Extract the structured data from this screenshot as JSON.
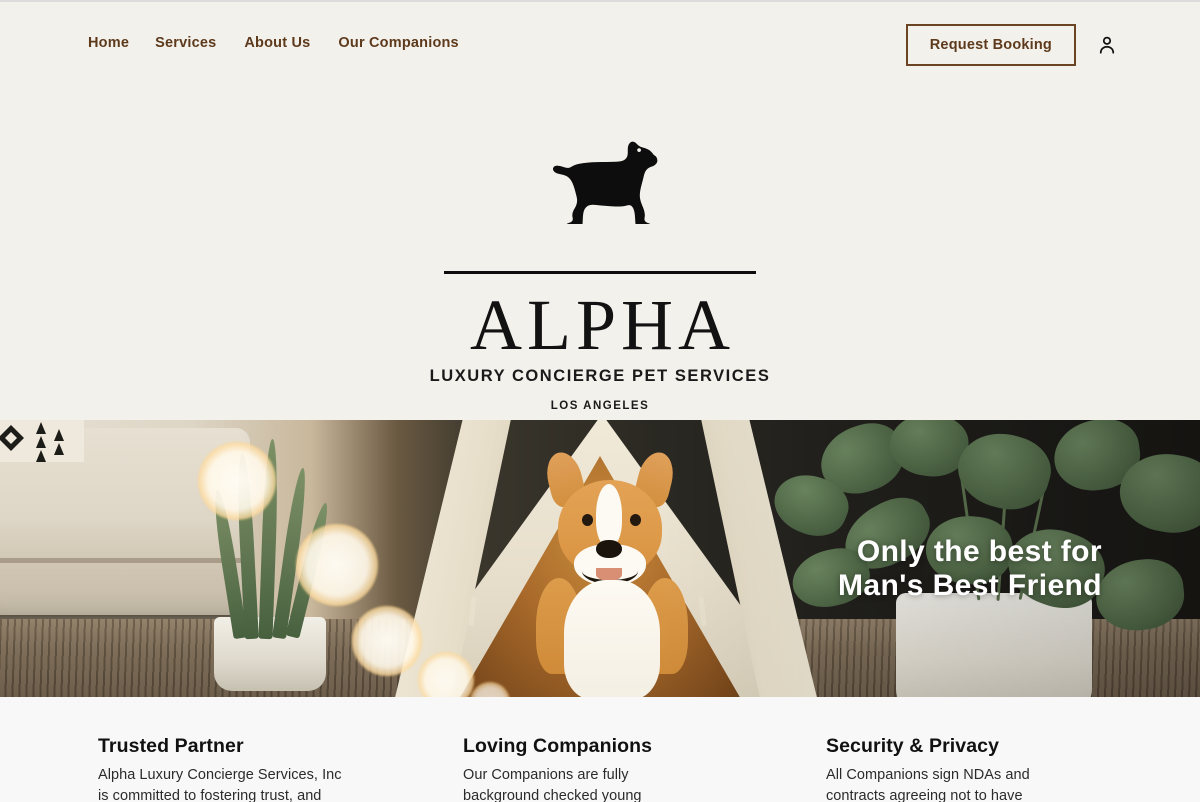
{
  "nav": {
    "links": [
      {
        "label": "Home"
      },
      {
        "label": "Services"
      },
      {
        "label": "About Us"
      },
      {
        "label": "Our Companions"
      }
    ],
    "booking_button": "Request Booking",
    "account_icon": "person-icon"
  },
  "logo": {
    "icon": "dog-silhouette-icon",
    "wordmark": "ALPHA",
    "tagline": "LUXURY CONCIERGE PET SERVICES",
    "city": "LOS ANGELES"
  },
  "hero": {
    "headline": "Only the best for\nMan's Best Friend",
    "image_alt": "corgi-in-teepee-photo"
  },
  "features": [
    {
      "title": "Trusted Partner",
      "body": "Alpha Luxury Concierge Services, Inc\nis committed to fostering trust, and"
    },
    {
      "title": "Loving Companions",
      "body": "Our Companions are fully\nbackground checked young"
    },
    {
      "title": "Security & Privacy",
      "body": "All Companions sign NDAs and\ncontracts agreeing not to have"
    }
  ],
  "colors": {
    "header_bg": "#f3f1ec",
    "features_bg": "#f8f8f8",
    "brand_brown": "#5e3a1c",
    "border_brown": "#6b4423",
    "logo_black": "#121212",
    "hero_text": "#ffffff"
  }
}
